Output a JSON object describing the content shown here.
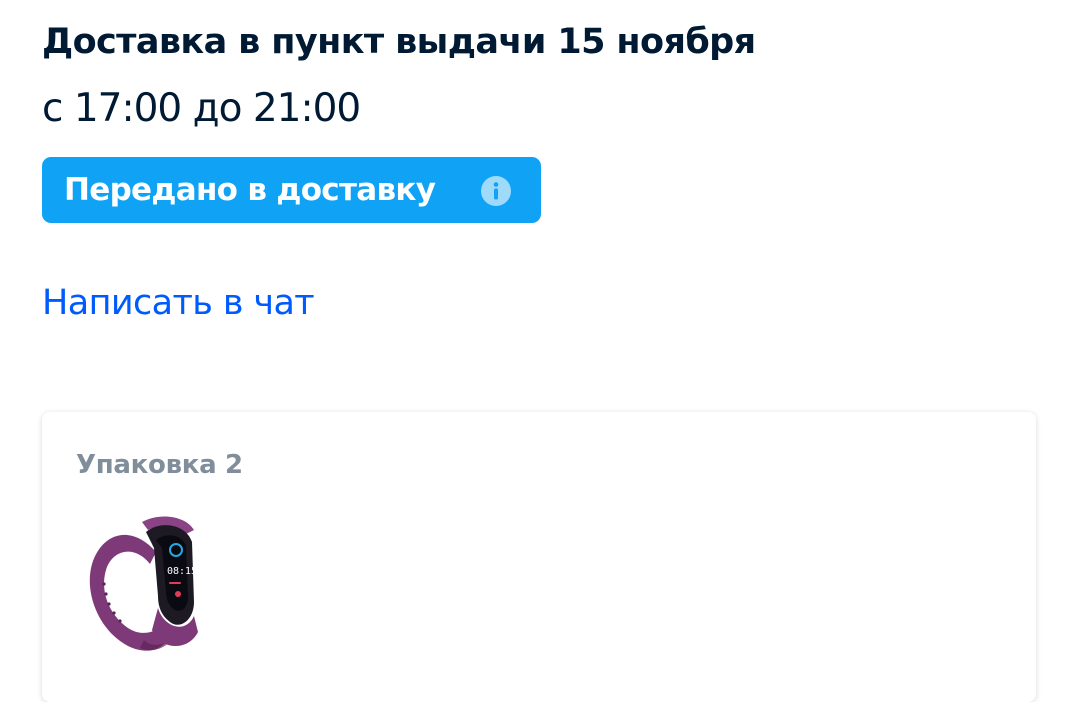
{
  "delivery": {
    "title": "Доставка в пункт выдачи 15 ноября",
    "time_window": "с 17:00 до 21:00"
  },
  "status": {
    "label": "Передано в доставку",
    "icon": "info-icon",
    "color": "#10a3f5"
  },
  "chat_link": {
    "label": "Написать в чат",
    "color": "#005bff"
  },
  "package": {
    "title": "Упаковка 2",
    "items": [
      {
        "image": "smart-band-purple",
        "screen_time": "08:15"
      }
    ]
  }
}
